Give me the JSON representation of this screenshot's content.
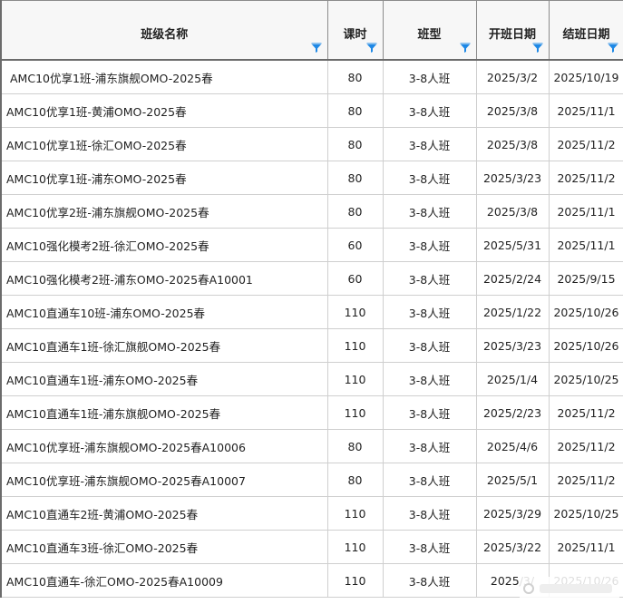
{
  "table": {
    "headers": {
      "name": "班级名称",
      "hours": "课时",
      "type": "班型",
      "start": "开班日期",
      "end": "结班日期"
    },
    "filter_icon": "filter-icon",
    "filter_color": "#1e88e5",
    "rows": [
      {
        "name": "AMC10优享1班-浦东旗舰OMO-2025春",
        "hours": "80",
        "type": "3-8人班",
        "start": "2025/3/2",
        "end": "2025/10/19"
      },
      {
        "name": "AMC10优享1班-黄浦OMO-2025春",
        "hours": "80",
        "type": "3-8人班",
        "start": "2025/3/8",
        "end": "2025/11/1"
      },
      {
        "name": "AMC10优享1班-徐汇OMO-2025春",
        "hours": "80",
        "type": "3-8人班",
        "start": "2025/3/8",
        "end": "2025/11/2"
      },
      {
        "name": "AMC10优享1班-浦东OMO-2025春",
        "hours": "80",
        "type": "3-8人班",
        "start": "2025/3/23",
        "end": "2025/11/2"
      },
      {
        "name": "AMC10优享2班-浦东旗舰OMO-2025春",
        "hours": "80",
        "type": "3-8人班",
        "start": "2025/3/8",
        "end": "2025/11/1"
      },
      {
        "name": "AMC10强化模考2班-徐汇OMO-2025春",
        "hours": "60",
        "type": "3-8人班",
        "start": "2025/5/31",
        "end": "2025/11/1"
      },
      {
        "name": "AMC10强化模考2班-浦东OMO-2025春A10001",
        "hours": "60",
        "type": "3-8人班",
        "start": "2025/2/24",
        "end": "2025/9/15"
      },
      {
        "name": "AMC10直通车10班-浦东OMO-2025春",
        "hours": "110",
        "type": "3-8人班",
        "start": "2025/1/22",
        "end": "2025/10/26"
      },
      {
        "name": "AMC10直通车1班-徐汇旗舰OMO-2025春",
        "hours": "110",
        "type": "3-8人班",
        "start": "2025/3/23",
        "end": "2025/10/26"
      },
      {
        "name": "AMC10直通车1班-浦东OMO-2025春",
        "hours": "110",
        "type": "3-8人班",
        "start": "2025/1/4",
        "end": "2025/10/25"
      },
      {
        "name": "AMC10直通车1班-浦东旗舰OMO-2025春",
        "hours": "110",
        "type": "3-8人班",
        "start": "2025/2/23",
        "end": "2025/11/2"
      },
      {
        "name": "AMC10优享班-浦东旗舰OMO-2025春A10006",
        "hours": "80",
        "type": "3-8人班",
        "start": "2025/4/6",
        "end": "2025/11/2"
      },
      {
        "name": "AMC10优享班-浦东旗舰OMO-2025春A10007",
        "hours": "80",
        "type": "3-8人班",
        "start": "2025/5/1",
        "end": "2025/11/2"
      },
      {
        "name": "AMC10直通车2班-黄浦OMO-2025春",
        "hours": "110",
        "type": "3-8人班",
        "start": "2025/3/29",
        "end": "2025/10/25"
      },
      {
        "name": "AMC10直通车3班-徐汇OMO-2025春",
        "hours": "110",
        "type": "3-8人班",
        "start": "2025/3/22",
        "end": "2025/11/1"
      },
      {
        "name": "AMC10直通车-徐汇OMO-2025春A10009",
        "hours": "110",
        "type": "3-8人班",
        "start": "2025/3/",
        "end": "2025/10/26"
      }
    ]
  }
}
